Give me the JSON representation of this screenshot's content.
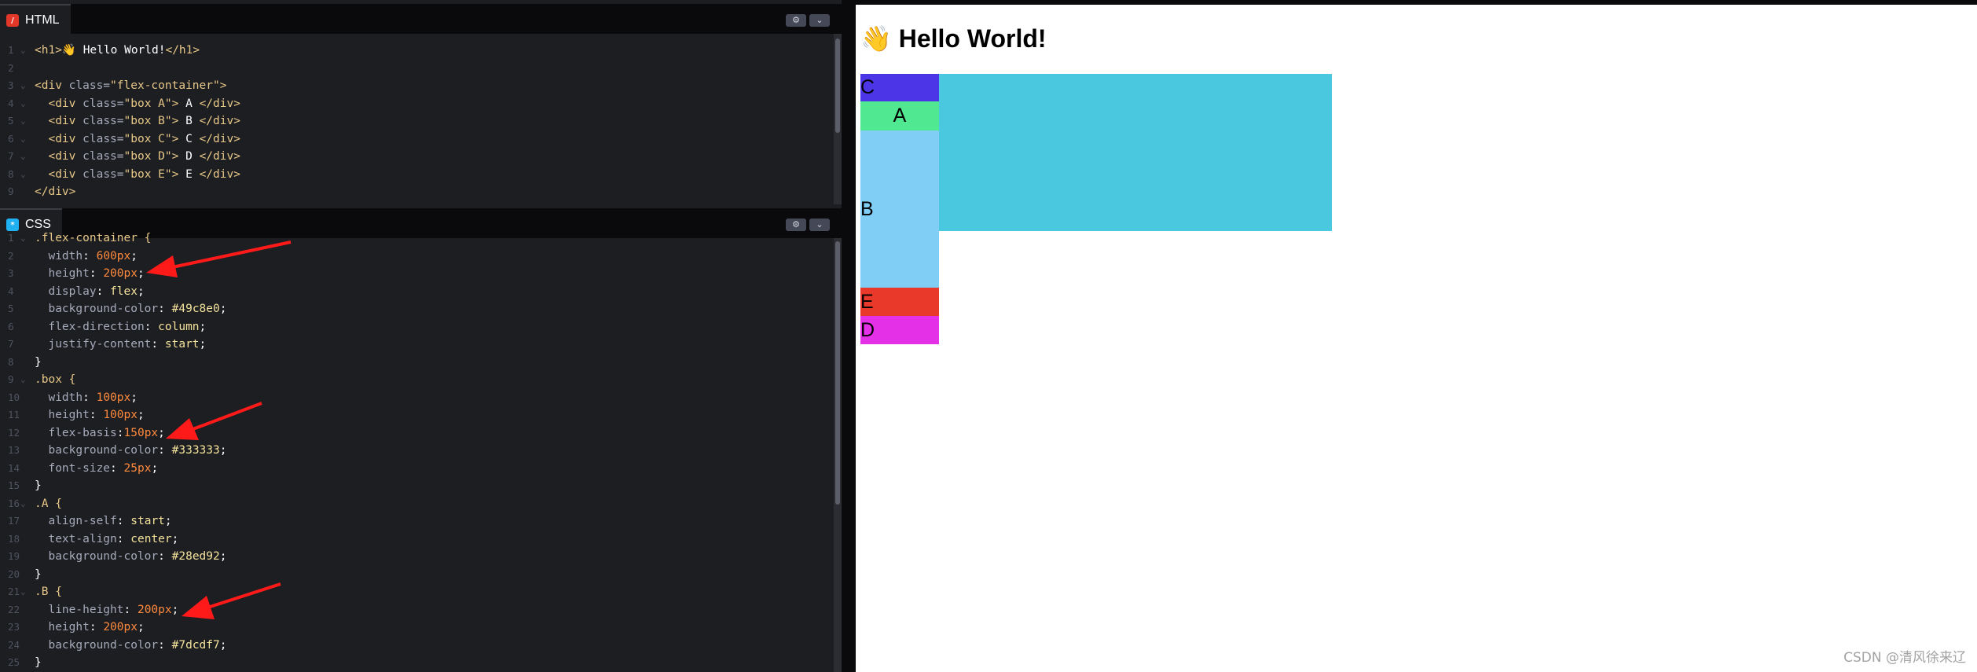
{
  "html_panel": {
    "tab_label": "HTML",
    "icon": "html-icon",
    "lines": [
      {
        "n": "1",
        "fold": "⌄",
        "tokens": [
          [
            "tag",
            "<h1>"
          ],
          [
            "plain",
            "👋 Hello World!"
          ],
          [
            "tag",
            "</h1>"
          ]
        ]
      },
      {
        "n": "2",
        "fold": "",
        "tokens": []
      },
      {
        "n": "3",
        "fold": "⌄",
        "tokens": [
          [
            "tag",
            "<div "
          ],
          [
            "attr",
            "class="
          ],
          [
            "str",
            "\"flex-container\""
          ],
          [
            "tag",
            ">"
          ]
        ]
      },
      {
        "n": "4",
        "fold": "⌄",
        "tokens": [
          [
            "plain",
            "  "
          ],
          [
            "tag",
            "<div "
          ],
          [
            "attr",
            "class="
          ],
          [
            "str",
            "\"box A\""
          ],
          [
            "tag",
            ">"
          ],
          [
            "plain",
            " A "
          ],
          [
            "tag",
            "</div>"
          ]
        ]
      },
      {
        "n": "5",
        "fold": "⌄",
        "tokens": [
          [
            "plain",
            "  "
          ],
          [
            "tag",
            "<div "
          ],
          [
            "attr",
            "class="
          ],
          [
            "str",
            "\"box B\""
          ],
          [
            "tag",
            ">"
          ],
          [
            "plain",
            " B "
          ],
          [
            "tag",
            "</div>"
          ]
        ]
      },
      {
        "n": "6",
        "fold": "⌄",
        "tokens": [
          [
            "plain",
            "  "
          ],
          [
            "tag",
            "<div "
          ],
          [
            "attr",
            "class="
          ],
          [
            "str",
            "\"box C\""
          ],
          [
            "tag",
            ">"
          ],
          [
            "plain",
            " C "
          ],
          [
            "tag",
            "</div>"
          ]
        ]
      },
      {
        "n": "7",
        "fold": "⌄",
        "tokens": [
          [
            "plain",
            "  "
          ],
          [
            "tag",
            "<div "
          ],
          [
            "attr",
            "class="
          ],
          [
            "str",
            "\"box D\""
          ],
          [
            "tag",
            ">"
          ],
          [
            "plain",
            " D "
          ],
          [
            "tag",
            "</div>"
          ]
        ]
      },
      {
        "n": "8",
        "fold": "⌄",
        "tokens": [
          [
            "plain",
            "  "
          ],
          [
            "tag",
            "<div "
          ],
          [
            "attr",
            "class="
          ],
          [
            "str",
            "\"box E\""
          ],
          [
            "tag",
            ">"
          ],
          [
            "plain",
            " E "
          ],
          [
            "tag",
            "</div>"
          ]
        ]
      },
      {
        "n": "9",
        "fold": "",
        "tokens": [
          [
            "tag",
            "</div>"
          ]
        ]
      }
    ]
  },
  "css_panel": {
    "tab_label": "CSS",
    "icon": "css-icon",
    "lines": [
      {
        "n": "1",
        "fold": "⌄",
        "tokens": [
          [
            "sel",
            ".flex-container {"
          ]
        ]
      },
      {
        "n": "2",
        "fold": "",
        "tokens": [
          [
            "plain",
            "  "
          ],
          [
            "prop",
            "width"
          ],
          [
            "plain",
            ": "
          ],
          [
            "num",
            "600px"
          ],
          [
            "plain",
            ";"
          ]
        ]
      },
      {
        "n": "3",
        "fold": "",
        "tokens": [
          [
            "plain",
            "  "
          ],
          [
            "prop",
            "height"
          ],
          [
            "plain",
            ": "
          ],
          [
            "num",
            "200px"
          ],
          [
            "plain",
            ";"
          ]
        ]
      },
      {
        "n": "4",
        "fold": "",
        "tokens": [
          [
            "plain",
            "  "
          ],
          [
            "prop",
            "display"
          ],
          [
            "plain",
            ": "
          ],
          [
            "kw",
            "flex"
          ],
          [
            "plain",
            ";"
          ]
        ]
      },
      {
        "n": "5",
        "fold": "",
        "tokens": [
          [
            "plain",
            "  "
          ],
          [
            "prop",
            "background-color"
          ],
          [
            "plain",
            ": "
          ],
          [
            "kw",
            "#49c8e0"
          ],
          [
            "plain",
            ";"
          ]
        ]
      },
      {
        "n": "6",
        "fold": "",
        "tokens": [
          [
            "plain",
            "  "
          ],
          [
            "prop",
            "flex-direction"
          ],
          [
            "plain",
            ": "
          ],
          [
            "kw",
            "column"
          ],
          [
            "plain",
            ";"
          ]
        ]
      },
      {
        "n": "7",
        "fold": "",
        "tokens": [
          [
            "plain",
            "  "
          ],
          [
            "prop",
            "justify-content"
          ],
          [
            "plain",
            ": "
          ],
          [
            "kw",
            "start"
          ],
          [
            "plain",
            ";"
          ]
        ]
      },
      {
        "n": "8",
        "fold": "",
        "tokens": [
          [
            "plain",
            "}"
          ]
        ]
      },
      {
        "n": "9",
        "fold": "⌄",
        "tokens": [
          [
            "sel",
            ".box {"
          ]
        ]
      },
      {
        "n": "10",
        "fold": "",
        "tokens": [
          [
            "plain",
            "  "
          ],
          [
            "prop",
            "width"
          ],
          [
            "plain",
            ": "
          ],
          [
            "num",
            "100px"
          ],
          [
            "plain",
            ";"
          ]
        ]
      },
      {
        "n": "11",
        "fold": "",
        "tokens": [
          [
            "plain",
            "  "
          ],
          [
            "prop",
            "height"
          ],
          [
            "plain",
            ": "
          ],
          [
            "num",
            "100px"
          ],
          [
            "plain",
            ";"
          ]
        ]
      },
      {
        "n": "12",
        "fold": "",
        "tokens": [
          [
            "plain",
            "  "
          ],
          [
            "prop",
            "flex-basis"
          ],
          [
            "plain",
            ":"
          ],
          [
            "num",
            "150px"
          ],
          [
            "plain",
            ";"
          ]
        ]
      },
      {
        "n": "13",
        "fold": "",
        "tokens": [
          [
            "plain",
            "  "
          ],
          [
            "prop",
            "background-color"
          ],
          [
            "plain",
            ": "
          ],
          [
            "kw",
            "#333333"
          ],
          [
            "plain",
            ";"
          ]
        ]
      },
      {
        "n": "14",
        "fold": "",
        "tokens": [
          [
            "plain",
            "  "
          ],
          [
            "prop",
            "font-size"
          ],
          [
            "plain",
            ": "
          ],
          [
            "num",
            "25px"
          ],
          [
            "plain",
            ";"
          ]
        ]
      },
      {
        "n": "15",
        "fold": "",
        "tokens": [
          [
            "plain",
            "}"
          ]
        ]
      },
      {
        "n": "16",
        "fold": "⌄",
        "tokens": [
          [
            "sel",
            ".A {"
          ]
        ]
      },
      {
        "n": "17",
        "fold": "",
        "tokens": [
          [
            "plain",
            "  "
          ],
          [
            "prop",
            "align-self"
          ],
          [
            "plain",
            ": "
          ],
          [
            "kw",
            "start"
          ],
          [
            "plain",
            ";"
          ]
        ]
      },
      {
        "n": "18",
        "fold": "",
        "tokens": [
          [
            "plain",
            "  "
          ],
          [
            "prop",
            "text-align"
          ],
          [
            "plain",
            ": "
          ],
          [
            "kw",
            "center"
          ],
          [
            "plain",
            ";"
          ]
        ]
      },
      {
        "n": "19",
        "fold": "",
        "tokens": [
          [
            "plain",
            "  "
          ],
          [
            "prop",
            "background-color"
          ],
          [
            "plain",
            ": "
          ],
          [
            "kw",
            "#28ed92"
          ],
          [
            "plain",
            ";"
          ]
        ]
      },
      {
        "n": "20",
        "fold": "",
        "tokens": [
          [
            "plain",
            "}"
          ]
        ]
      },
      {
        "n": "21",
        "fold": "⌄",
        "tokens": [
          [
            "sel",
            ".B {"
          ]
        ]
      },
      {
        "n": "22",
        "fold": "",
        "tokens": [
          [
            "plain",
            "  "
          ],
          [
            "prop",
            "line-height"
          ],
          [
            "plain",
            ": "
          ],
          [
            "num",
            "200px"
          ],
          [
            "plain",
            ";"
          ]
        ]
      },
      {
        "n": "23",
        "fold": "",
        "tokens": [
          [
            "plain",
            "  "
          ],
          [
            "prop",
            "height"
          ],
          [
            "plain",
            ": "
          ],
          [
            "num",
            "200px"
          ],
          [
            "plain",
            ";"
          ]
        ]
      },
      {
        "n": "24",
        "fold": "",
        "tokens": [
          [
            "plain",
            "  "
          ],
          [
            "prop",
            "background-color"
          ],
          [
            "plain",
            ": "
          ],
          [
            "kw",
            "#7dcdf7"
          ],
          [
            "plain",
            ";"
          ]
        ]
      },
      {
        "n": "25",
        "fold": "",
        "tokens": [
          [
            "plain",
            "}"
          ]
        ]
      }
    ]
  },
  "settings_icon": "gear-icon",
  "collapse_icon": "chevron-down-icon",
  "preview": {
    "title": "👋 Hello World!",
    "container_color": "#49c8e0",
    "boxes": [
      {
        "label": "C",
        "color": "#4b35e6",
        "align": "left"
      },
      {
        "label": "A",
        "color": "#50e890",
        "align": "center"
      },
      {
        "label": "B",
        "color": "#80cef6",
        "align": "left"
      },
      {
        "label": "E",
        "color": "#e9392b",
        "align": "left"
      },
      {
        "label": "D",
        "color": "#e430e6",
        "align": "left"
      }
    ]
  },
  "watermark": "CSDN @清风徐来辽",
  "colors": {
    "editor_bg": "#1d1e22",
    "header_bg": "#0a0a0c",
    "html_icon": "#e3372a",
    "css_icon": "#1fb1f2",
    "annotation_arrow": "#ff1a1a"
  }
}
